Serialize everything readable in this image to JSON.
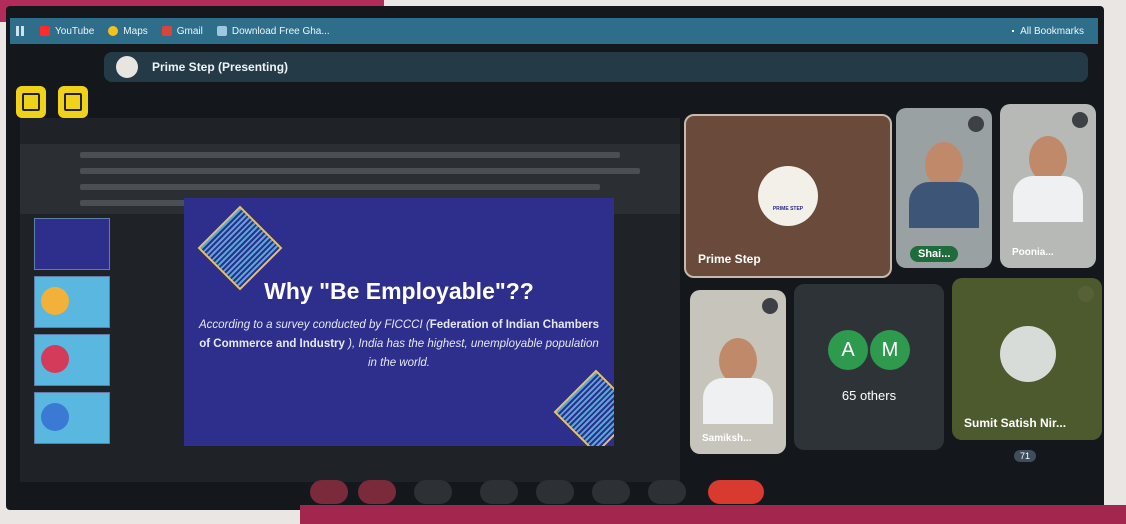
{
  "bookmarks_bar": {
    "items": [
      {
        "label": "YouTube",
        "icon": "youtube-icon",
        "color": "#ff2a2a"
      },
      {
        "label": "Maps",
        "icon": "maps-icon",
        "color": "#f4c21a"
      },
      {
        "label": "Gmail",
        "icon": "gmail-icon",
        "color": "#d9453a"
      },
      {
        "label": "Download Free Gha...",
        "icon": "page-icon",
        "color": "#9ec8e0"
      }
    ],
    "all_bookmarks_label": "All Bookmarks"
  },
  "meet_bar": {
    "title": "Prime Step (Presenting)"
  },
  "slide": {
    "title": "Why \"Be Employable\"??",
    "body_1": "According to a survey conducted by FICCCI (",
    "body_bold": "Federation of Indian Chambers of Commerce and Industry",
    "body_2": " ), India has the highest, unemployable population in the world."
  },
  "participants": {
    "presenter_name": "Prime Step",
    "presenter_logo_text": "PRIME STEP",
    "p1_name": "Shai...",
    "p2_name": "Poonia...",
    "p3_name": "Samiksh...",
    "group_avatars": [
      "A",
      "M"
    ],
    "others_label": "65 others",
    "p4_name": "Sumit Satish Nir...",
    "participant_count": "71"
  },
  "colors": {
    "accent_yellow": "#f0d21a",
    "avatar_green": "#2e9a4e",
    "end_call_red": "#d93a30"
  }
}
